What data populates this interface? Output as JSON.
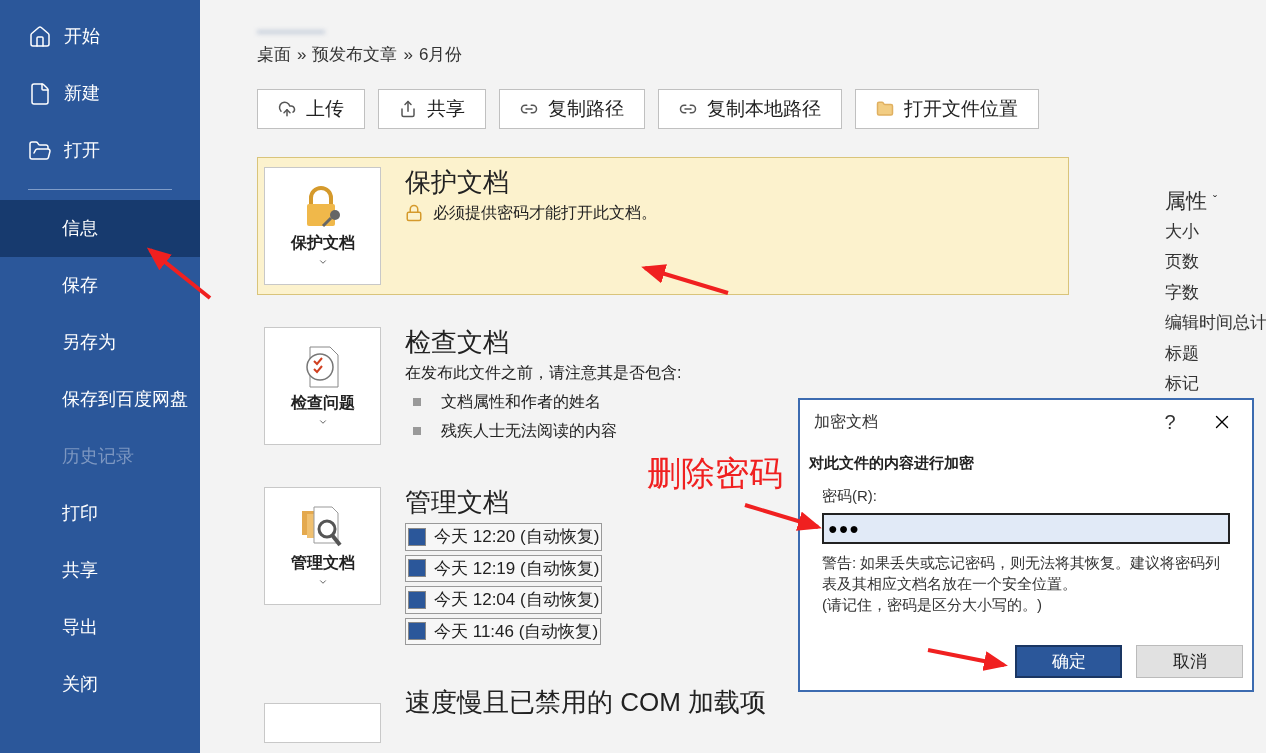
{
  "sidebar": {
    "items": [
      {
        "label": "开始",
        "selected": false,
        "disabled": false
      },
      {
        "label": "新建",
        "selected": false,
        "disabled": false
      },
      {
        "label": "打开",
        "selected": false,
        "disabled": false
      },
      {
        "label": "信息",
        "selected": true,
        "disabled": false
      },
      {
        "label": "保存",
        "selected": false,
        "disabled": false
      },
      {
        "label": "另存为",
        "selected": false,
        "disabled": false
      },
      {
        "label": "保存到百度网盘",
        "selected": false,
        "disabled": false
      },
      {
        "label": "历史记录",
        "selected": false,
        "disabled": true
      },
      {
        "label": "打印",
        "selected": false,
        "disabled": false
      },
      {
        "label": "共享",
        "selected": false,
        "disabled": false
      },
      {
        "label": "导出",
        "selected": false,
        "disabled": false
      },
      {
        "label": "关闭",
        "selected": false,
        "disabled": false
      }
    ]
  },
  "breadcrumb": [
    "桌面",
    "»",
    "预发布文章",
    "»",
    "6月份"
  ],
  "toolbar": [
    {
      "label": "上传"
    },
    {
      "label": "共享"
    },
    {
      "label": "复制路径"
    },
    {
      "label": "复制本地路径"
    },
    {
      "label": "打开文件位置"
    }
  ],
  "sections": [
    {
      "kind": "protect",
      "highlighted": true,
      "tile_label": "保护文档",
      "title": "保护文档",
      "description": "必须提供密码才能打开此文档。"
    },
    {
      "kind": "inspect",
      "highlighted": false,
      "tile_label": "检查问题",
      "title": "检查文档",
      "description": "在发布此文件之前，请注意其是否包含:",
      "bullets": [
        "文档属性和作者的姓名",
        "残疾人士无法阅读的内容"
      ]
    },
    {
      "kind": "manage",
      "highlighted": false,
      "tile_label": "管理文档",
      "title": "管理文档",
      "versions": [
        "今天 12:20 (自动恢复)",
        "今天 12:19 (自动恢复)",
        "今天 12:04 (自动恢复)",
        "今天 11:46 (自动恢复)"
      ]
    },
    {
      "kind": "com",
      "highlighted": false,
      "title": "速度慢且已禁用的 COM 加载项"
    }
  ],
  "properties": {
    "title": "属性",
    "caret": "ˇ",
    "items": [
      "大小",
      "页数",
      "字数",
      "编辑时间总计",
      "标题",
      "标记"
    ]
  },
  "annotation": "删除密码",
  "dialog": {
    "title": "加密文档",
    "help": "?",
    "heading": "对此文件的内容进行加密",
    "field_label": "密码(R):",
    "value": "●●●",
    "warning": "警告: 如果丢失或忘记密码，则无法将其恢复。建议将密码列表及其相应文档名放在一个安全位置。",
    "note": "(请记住，密码是区分大小写的。)",
    "buttons": [
      {
        "label": "确定",
        "primary": true
      },
      {
        "label": "取消",
        "primary": false
      }
    ]
  }
}
